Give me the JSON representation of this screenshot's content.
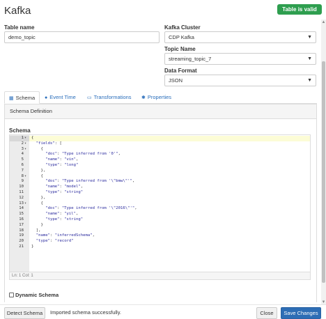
{
  "header": {
    "title": "Kafka",
    "status_badge": "Table is valid"
  },
  "form": {
    "table_name_label": "Table name",
    "table_name_value": "demo_topic",
    "kafka_cluster_label": "Kafka Cluster",
    "kafka_cluster_value": "CDP Kafka",
    "topic_name_label": "Topic Name",
    "topic_name_value": "streaming_topic_7",
    "data_format_label": "Data Format",
    "data_format_value": "JSON"
  },
  "tabs": [
    {
      "label": "Schema",
      "icon": "table-icon",
      "active": true
    },
    {
      "label": "Event Time",
      "icon": "clock-icon",
      "active": false
    },
    {
      "label": "Transformations",
      "icon": "monitor-icon",
      "active": false
    },
    {
      "label": "Properties",
      "icon": "gear-icon",
      "active": false
    }
  ],
  "panel": {
    "header": "Schema Definition",
    "schema_label": "Schema"
  },
  "editor": {
    "lines": [
      {
        "n": "1",
        "fold": "▾",
        "text": "{"
      },
      {
        "n": "2",
        "fold": "▾",
        "text": "  \"fields\": ["
      },
      {
        "n": "3",
        "fold": "▾",
        "text": "    {"
      },
      {
        "n": "4",
        "fold": "",
        "text": "      \"doc\": \"Type inferred from '0'\","
      },
      {
        "n": "5",
        "fold": "",
        "text": "      \"name\": \"vin\","
      },
      {
        "n": "6",
        "fold": "",
        "text": "      \"type\": \"long\""
      },
      {
        "n": "7",
        "fold": "",
        "text": "    },"
      },
      {
        "n": "8",
        "fold": "▾",
        "text": "    {"
      },
      {
        "n": "9",
        "fold": "",
        "text": "      \"doc\": \"Type inferred from '\\\"bmw\\\"'\","
      },
      {
        "n": "10",
        "fold": "",
        "text": "      \"name\": \"model\","
      },
      {
        "n": "11",
        "fold": "",
        "text": "      \"type\": \"string\""
      },
      {
        "n": "12",
        "fold": "",
        "text": "    },"
      },
      {
        "n": "13",
        "fold": "▾",
        "text": "    {"
      },
      {
        "n": "14",
        "fold": "",
        "text": "      \"doc\": \"Type inferred from '\\\"2016\\\"'\","
      },
      {
        "n": "15",
        "fold": "",
        "text": "      \"name\": \"yil\","
      },
      {
        "n": "16",
        "fold": "",
        "text": "      \"type\": \"string\""
      },
      {
        "n": "17",
        "fold": "",
        "text": "    }"
      },
      {
        "n": "18",
        "fold": "",
        "text": "  ],"
      },
      {
        "n": "19",
        "fold": "",
        "text": "  \"name\": \"inferredSchema\","
      },
      {
        "n": "20",
        "fold": "",
        "text": "  \"type\": \"record\""
      },
      {
        "n": "21",
        "fold": "",
        "text": "}"
      }
    ],
    "status": "Ln: 1    Col: 1"
  },
  "dynamic_schema_label": "Dynamic Schema",
  "footer": {
    "detect_button": "Detect Schema",
    "message": "Imported schema successfully.",
    "close_button": "Close",
    "save_button": "Save Changes"
  },
  "colors": {
    "badge_green": "#2e9e4f",
    "primary_blue": "#2d6db5",
    "link_blue": "#2a6ebb"
  }
}
